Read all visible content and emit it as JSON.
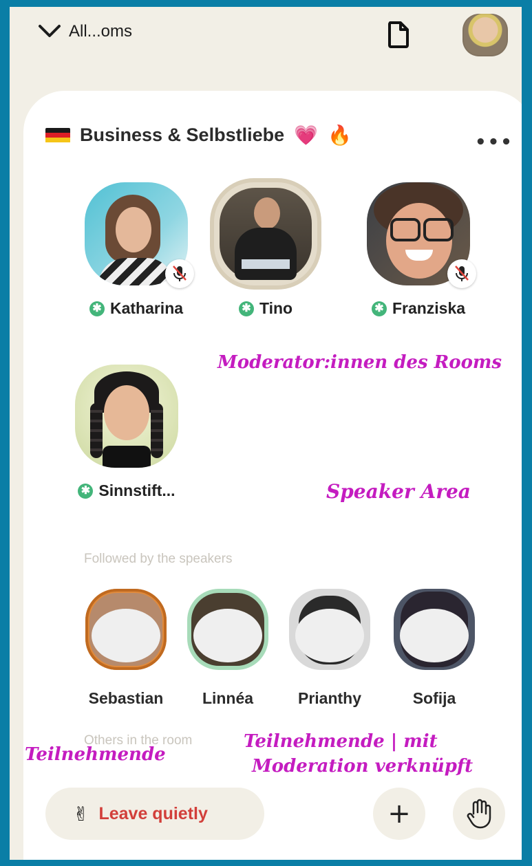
{
  "header": {
    "back_label": "All...oms"
  },
  "room": {
    "title": "Business & Selbstliebe",
    "heart_emoji": "💗",
    "fire_emoji": "🔥",
    "more_label": "•••"
  },
  "speakers": [
    {
      "name": "Katharina",
      "muted": true
    },
    {
      "name": "Tino",
      "muted": false
    },
    {
      "name": "Franziska",
      "muted": true
    },
    {
      "name": "Sinnstift...",
      "muted": false
    }
  ],
  "annotations": {
    "moderators": "Moderator:innen des Rooms",
    "speaker_area": "Speaker Area",
    "participants": "Teilnehmende",
    "participants_mod_line1": "Teilnehmende | mit",
    "participants_mod_line2": "Moderation verknüpft"
  },
  "sections": {
    "followed": "Followed by the speakers",
    "others": "Others in the room"
  },
  "followers": [
    {
      "name": "Sebastian"
    },
    {
      "name": "Linnéa"
    },
    {
      "name": "Prianthy"
    },
    {
      "name": "Sofija"
    }
  ],
  "actions": {
    "leave_emoji": "✌",
    "leave_label": "Leave quietly",
    "add_label": "+"
  },
  "colors": {
    "background": "#0a7ea6",
    "annotation": "#c41cc0",
    "moderator_badge": "#43b57a",
    "leave_text": "#d23f3a"
  }
}
